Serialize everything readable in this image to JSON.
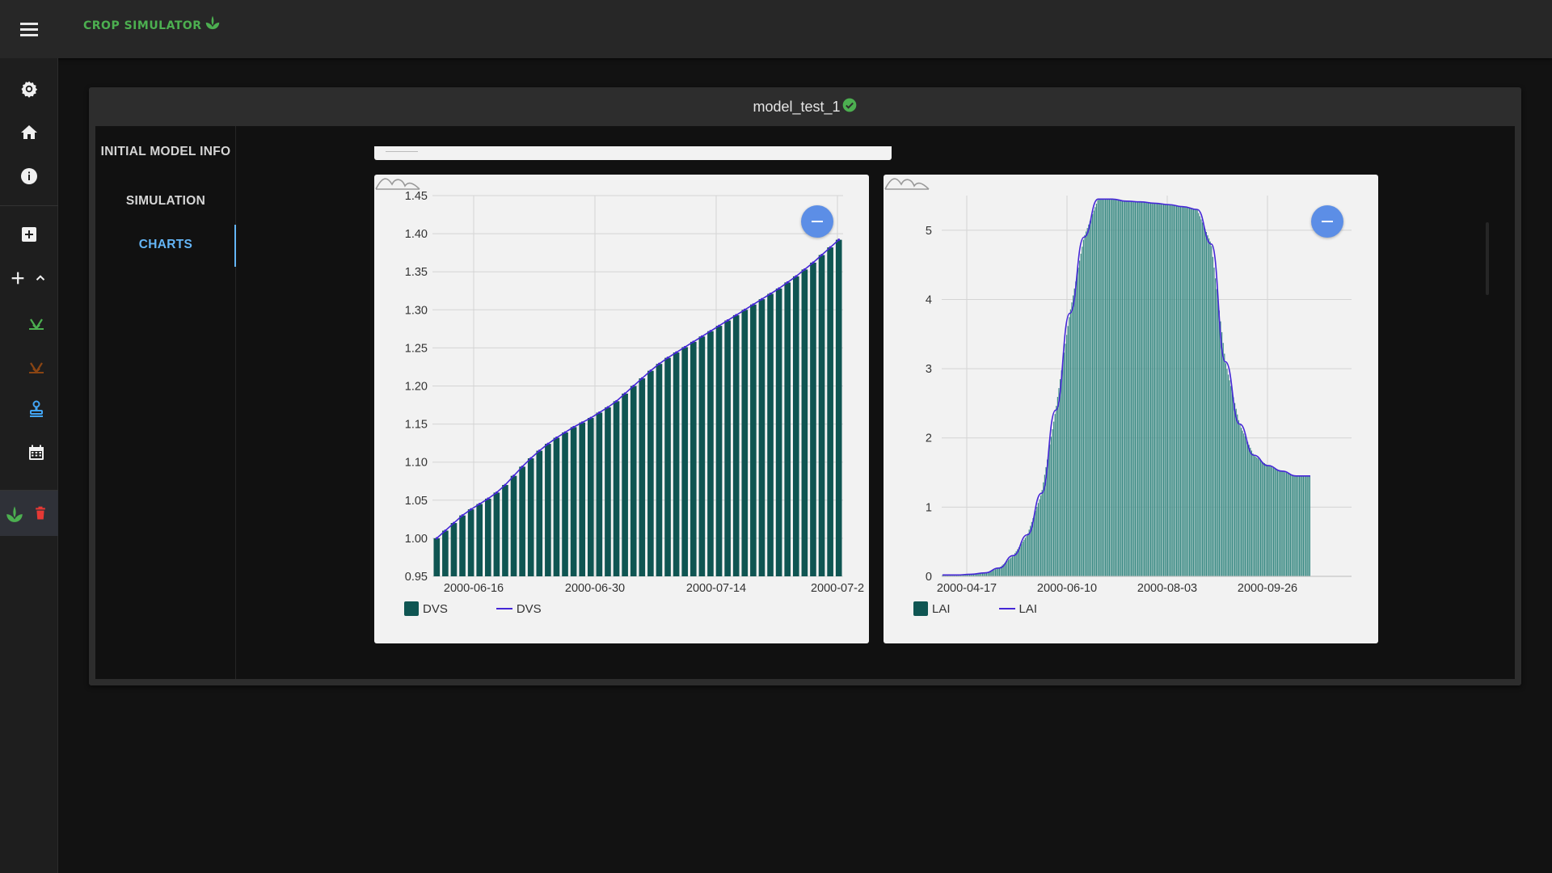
{
  "app": {
    "brand": "CROP SIMULATOR",
    "accent_color": "#4caf50"
  },
  "sidenav": {
    "icons": [
      "settings-icon",
      "home-icon",
      "info-icon",
      "add-box-icon",
      "add-icon",
      "chevron-up-icon",
      "crop-icon",
      "crop-icon",
      "stamp-icon",
      "calendar-icon",
      "crop-icon",
      "delete-icon"
    ]
  },
  "model": {
    "name": "model_test_1",
    "status_icon": "check-circle-icon"
  },
  "tabs": [
    {
      "label": "INITIAL MODEL INFO"
    },
    {
      "label": "SIMULATION"
    },
    {
      "label": "CHARTS",
      "active": true
    }
  ],
  "charts": [
    {
      "legend": {
        "bar": "DVS",
        "line": "DVS"
      },
      "bar_color": "#0f5552",
      "line_color": "#4527d6"
    },
    {
      "legend": {
        "bar": "LAI",
        "line": "LAI"
      },
      "bar_color": "#3c8b85",
      "line_color": "#4527d6"
    }
  ],
  "chart_data": [
    {
      "type": "bar",
      "y_tick_labels": [
        "0.95",
        "1.00",
        "1.05",
        "1.10",
        "1.15",
        "1.20",
        "1.25",
        "1.30",
        "1.35",
        "1.40",
        "1.45"
      ],
      "x_tick_labels": [
        "2000-06-16",
        "2000-06-30",
        "2000-07-14",
        "2000-07-2"
      ],
      "ylim": [
        0.95,
        1.45
      ],
      "grid": true,
      "legend_position": "bottom-left",
      "series": [
        {
          "name": "DVS",
          "type": "bar"
        },
        {
          "name": "DVS",
          "type": "line"
        }
      ],
      "x": [
        "2000-06-12",
        "2000-06-13",
        "2000-06-14",
        "2000-06-15",
        "2000-06-16",
        "2000-06-17",
        "2000-06-18",
        "2000-06-19",
        "2000-06-20",
        "2000-06-21",
        "2000-06-22",
        "2000-06-23",
        "2000-06-24",
        "2000-06-25",
        "2000-06-26",
        "2000-06-27",
        "2000-06-28",
        "2000-06-29",
        "2000-06-30",
        "2000-07-01",
        "2000-07-02",
        "2000-07-03",
        "2000-07-04",
        "2000-07-05",
        "2000-07-06",
        "2000-07-07",
        "2000-07-08",
        "2000-07-09",
        "2000-07-10",
        "2000-07-11",
        "2000-07-12",
        "2000-07-13",
        "2000-07-14",
        "2000-07-15",
        "2000-07-16",
        "2000-07-17",
        "2000-07-18",
        "2000-07-19",
        "2000-07-20",
        "2000-07-21",
        "2000-07-22",
        "2000-07-23",
        "2000-07-24",
        "2000-07-25",
        "2000-07-26",
        "2000-07-27",
        "2000-07-28",
        "2000-07-29"
      ],
      "values": [
        1.0,
        1.01,
        1.02,
        1.03,
        1.038,
        1.045,
        1.052,
        1.06,
        1.07,
        1.082,
        1.094,
        1.105,
        1.115,
        1.124,
        1.132,
        1.139,
        1.146,
        1.152,
        1.158,
        1.165,
        1.172,
        1.18,
        1.19,
        1.2,
        1.21,
        1.22,
        1.229,
        1.237,
        1.244,
        1.251,
        1.258,
        1.265,
        1.272,
        1.279,
        1.286,
        1.293,
        1.3,
        1.307,
        1.314,
        1.321,
        1.328,
        1.336,
        1.344,
        1.353,
        1.362,
        1.372,
        1.382,
        1.392
      ]
    },
    {
      "type": "area",
      "y_tick_labels": [
        "0",
        "1",
        "2",
        "3",
        "4",
        "5"
      ],
      "x_tick_labels": [
        "2000-04-17",
        "2000-06-10",
        "2000-08-03",
        "2000-09-26"
      ],
      "ylim": [
        0,
        5.5
      ],
      "grid": true,
      "legend_position": "bottom-left",
      "series": [
        {
          "name": "LAI",
          "type": "bar"
        },
        {
          "name": "LAI",
          "type": "line"
        }
      ],
      "x": [
        "2000-04-17",
        "2000-04-24",
        "2000-05-01",
        "2000-05-08",
        "2000-05-15",
        "2000-05-22",
        "2000-05-29",
        "2000-06-05",
        "2000-06-12",
        "2000-06-19",
        "2000-06-26",
        "2000-07-03",
        "2000-07-10",
        "2000-07-17",
        "2000-07-24",
        "2000-07-31",
        "2000-08-07",
        "2000-08-14",
        "2000-08-21",
        "2000-08-28",
        "2000-09-04",
        "2000-09-11",
        "2000-09-18",
        "2000-09-25",
        "2000-10-02",
        "2000-10-09",
        "2000-10-16"
      ],
      "values": [
        0.02,
        0.02,
        0.03,
        0.05,
        0.12,
        0.3,
        0.6,
        1.2,
        2.4,
        3.8,
        4.9,
        5.45,
        5.45,
        5.42,
        5.41,
        5.39,
        5.37,
        5.34,
        5.3,
        4.8,
        3.1,
        2.2,
        1.75,
        1.6,
        1.52,
        1.45,
        1.45
      ]
    }
  ]
}
